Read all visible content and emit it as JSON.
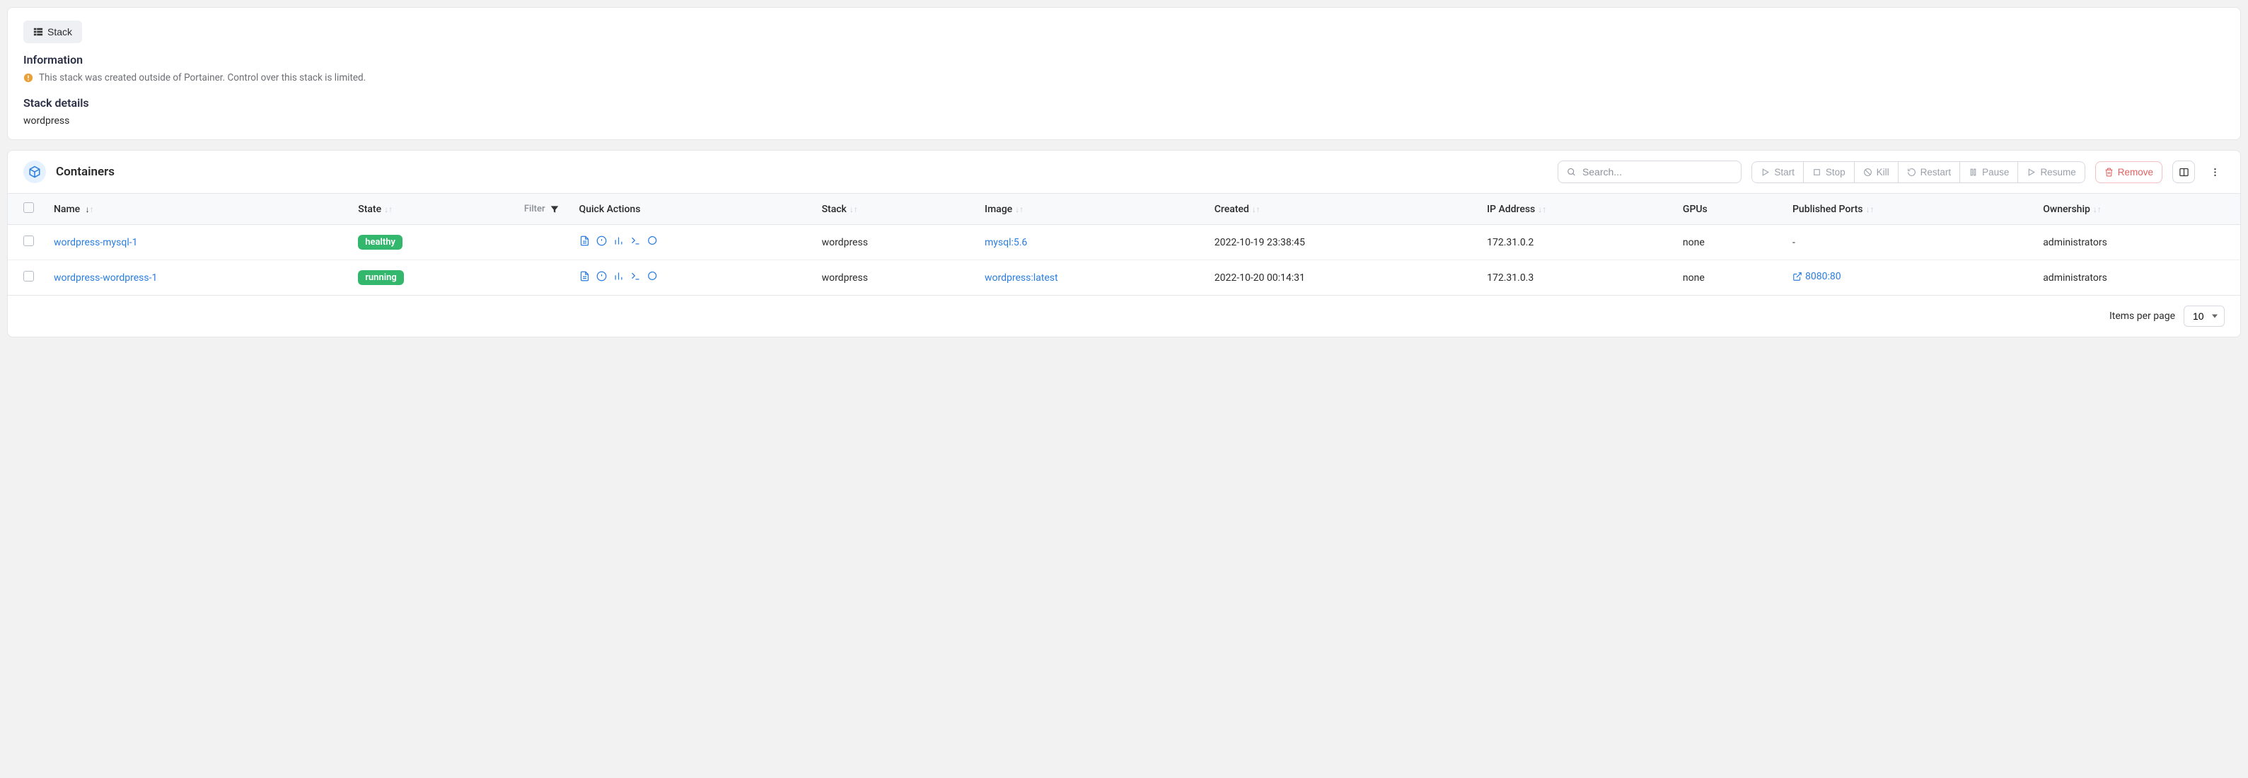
{
  "tab": {
    "label": "Stack"
  },
  "info": {
    "heading": "Information",
    "notice": "This stack was created outside of Portainer. Control over this stack is limited.",
    "details_heading": "Stack details",
    "stack_name": "wordpress"
  },
  "containers": {
    "title": "Containers",
    "search_placeholder": "Search...",
    "actions": {
      "start": "Start",
      "stop": "Stop",
      "kill": "Kill",
      "restart": "Restart",
      "pause": "Pause",
      "resume": "Resume",
      "remove": "Remove"
    },
    "columns": {
      "name": "Name",
      "state": "State",
      "filter": "Filter",
      "quick_actions": "Quick Actions",
      "stack": "Stack",
      "image": "Image",
      "created": "Created",
      "ip": "IP Address",
      "gpus": "GPUs",
      "ports": "Published Ports",
      "ownership": "Ownership"
    },
    "rows": [
      {
        "name": "wordpress-mysql-1",
        "state": "healthy",
        "stack": "wordpress",
        "image": "mysql:5.6",
        "created": "2022-10-19 23:38:45",
        "ip": "172.31.0.2",
        "gpus": "none",
        "ports": "-",
        "has_port_link": false,
        "ownership": "administrators"
      },
      {
        "name": "wordpress-wordpress-1",
        "state": "running",
        "stack": "wordpress",
        "image": "wordpress:latest",
        "created": "2022-10-20 00:14:31",
        "ip": "172.31.0.3",
        "gpus": "none",
        "ports": "8080:80",
        "has_port_link": true,
        "ownership": "administrators"
      }
    ],
    "footer": {
      "items_per_page_label": "Items per page",
      "items_per_page_value": "10"
    }
  }
}
